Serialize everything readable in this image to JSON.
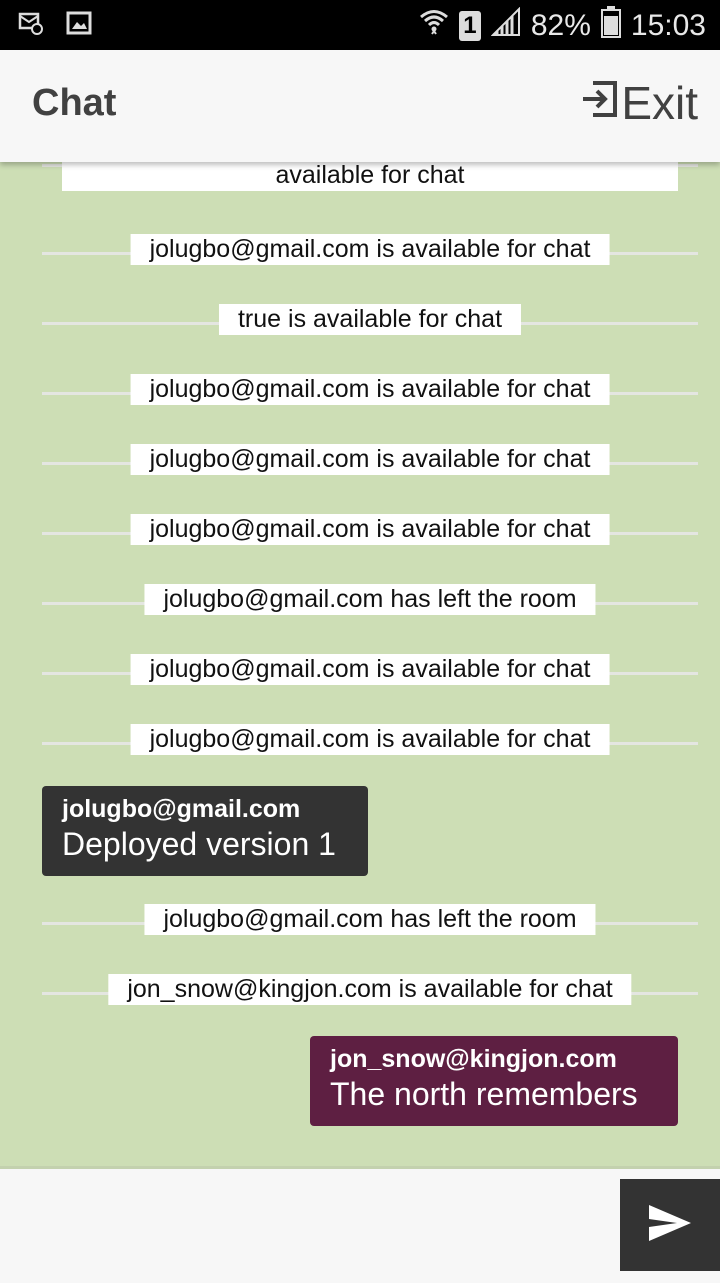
{
  "status_bar": {
    "battery_percent": "82%",
    "sim_slot": "1",
    "time": "15:03",
    "icons": [
      "email-notification-icon",
      "image-notification-icon",
      "wifi-icon",
      "signal-icon",
      "battery-icon"
    ]
  },
  "app_bar": {
    "title": "Chat",
    "exit_label": "Exit",
    "exit_icon": "exit-icon"
  },
  "messages": {
    "system": [
      "available for chat",
      "jolugbo@gmail.com is available for chat",
      "true is available for chat",
      "jolugbo@gmail.com is available for chat",
      "jolugbo@gmail.com is available for chat",
      "jolugbo@gmail.com is available for chat",
      "jolugbo@gmail.com has left the room",
      "jolugbo@gmail.com is available for chat",
      "jolugbo@gmail.com is available for chat",
      "jolugbo@gmail.com has left the room",
      "jon_snow@kingjon.com is available for chat"
    ],
    "incoming": {
      "sender": "jolugbo@gmail.com",
      "text": "Deployed version 1"
    },
    "outgoing": {
      "sender": "jon_snow@kingjon.com",
      "text": "The north remembers"
    }
  },
  "input": {
    "placeholder": "",
    "value": "",
    "send_icon": "send-icon"
  },
  "colors": {
    "chat_background": "#cddeb5",
    "incoming_bubble": "#333333",
    "outgoing_bubble": "#5e1f42",
    "app_bar": "#f7f7f7"
  }
}
